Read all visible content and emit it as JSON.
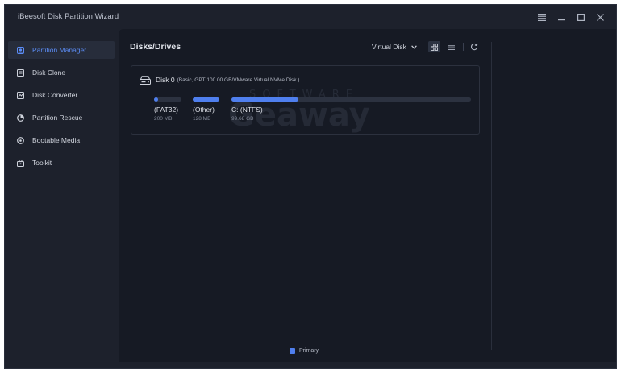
{
  "app": {
    "title": "iBeesoft Disk Partition Wizard"
  },
  "window_controls": {
    "menu_icon": "hamburger-icon",
    "minimize_icon": "minimize-icon",
    "maximize_icon": "maximize-icon",
    "close_icon": "close-icon"
  },
  "sidebar": {
    "items": [
      {
        "label": "Partition Manager",
        "icon": "partition-manager-icon",
        "active": true
      },
      {
        "label": "Disk Clone",
        "icon": "disk-clone-icon",
        "active": false
      },
      {
        "label": "Disk Converter",
        "icon": "disk-converter-icon",
        "active": false
      },
      {
        "label": "Partition Rescue",
        "icon": "partition-rescue-icon",
        "active": false
      },
      {
        "label": "Bootable Media",
        "icon": "bootable-media-icon",
        "active": false
      },
      {
        "label": "Toolkit",
        "icon": "toolkit-icon",
        "active": false
      }
    ]
  },
  "main": {
    "title": "Disks/Drives",
    "filter_label": "Virtual Disk",
    "disk": {
      "name": "Disk 0",
      "info": "(Basic, GPT 100.00 GB/VMware Virtual NVMe Disk )",
      "partitions": [
        {
          "name": "(FAT32)",
          "size": "200 MB",
          "used_fraction": 0.15
        },
        {
          "name": "(Other)",
          "size": "128 MB",
          "used_fraction": 1.0
        },
        {
          "name": "C: (NTFS)",
          "size": "99.68 GB",
          "used_fraction": 0.28
        }
      ]
    },
    "legend": {
      "label": "Primary",
      "color": "#4f7fee"
    }
  },
  "colors": {
    "accent": "#4f7fee",
    "active_nav_text": "#5b8cf5",
    "background": "#1d212c",
    "panel": "#161a24"
  }
}
